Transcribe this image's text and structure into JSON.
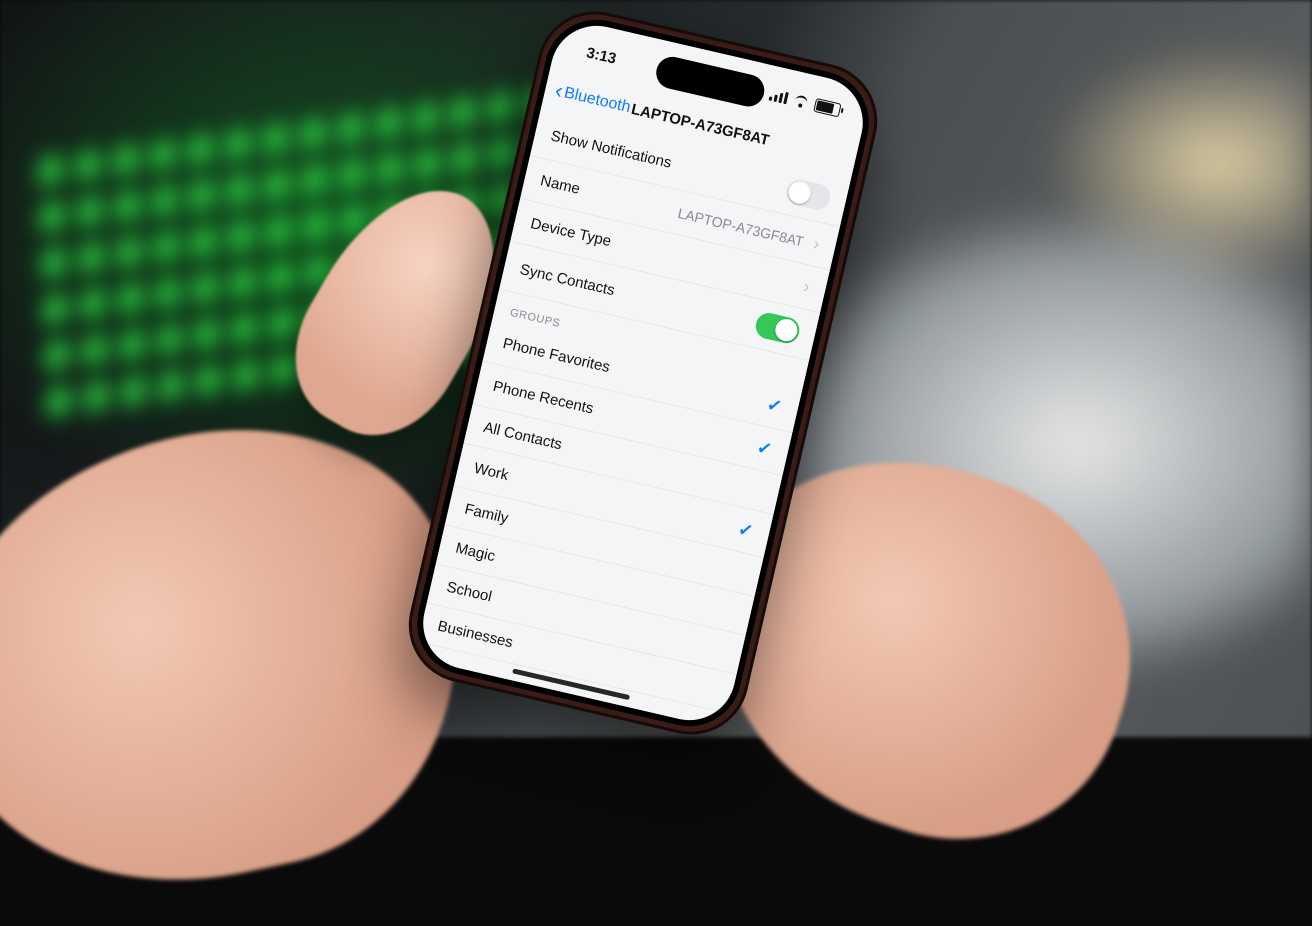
{
  "statusbar": {
    "time": "3:13"
  },
  "nav": {
    "back_label": "Bluetooth",
    "title": "LAPTOP-A73GF8AT"
  },
  "rows": {
    "show_notifications": {
      "label": "Show Notifications",
      "on": false
    },
    "name": {
      "label": "Name",
      "value": "LAPTOP-A73GF8AT"
    },
    "device_type": {
      "label": "Device Type",
      "value": ""
    },
    "sync_contacts": {
      "label": "Sync Contacts",
      "on": true
    }
  },
  "groups_header": "GROUPS",
  "groups": [
    {
      "label": "Phone Favorites",
      "checked": true
    },
    {
      "label": "Phone Recents",
      "checked": true
    },
    {
      "label": "All Contacts",
      "checked": false
    },
    {
      "label": "Work",
      "checked": true
    },
    {
      "label": "Family",
      "checked": false
    },
    {
      "label": "Magic",
      "checked": false
    },
    {
      "label": "School",
      "checked": false
    },
    {
      "label": "Businesses",
      "checked": false
    }
  ]
}
